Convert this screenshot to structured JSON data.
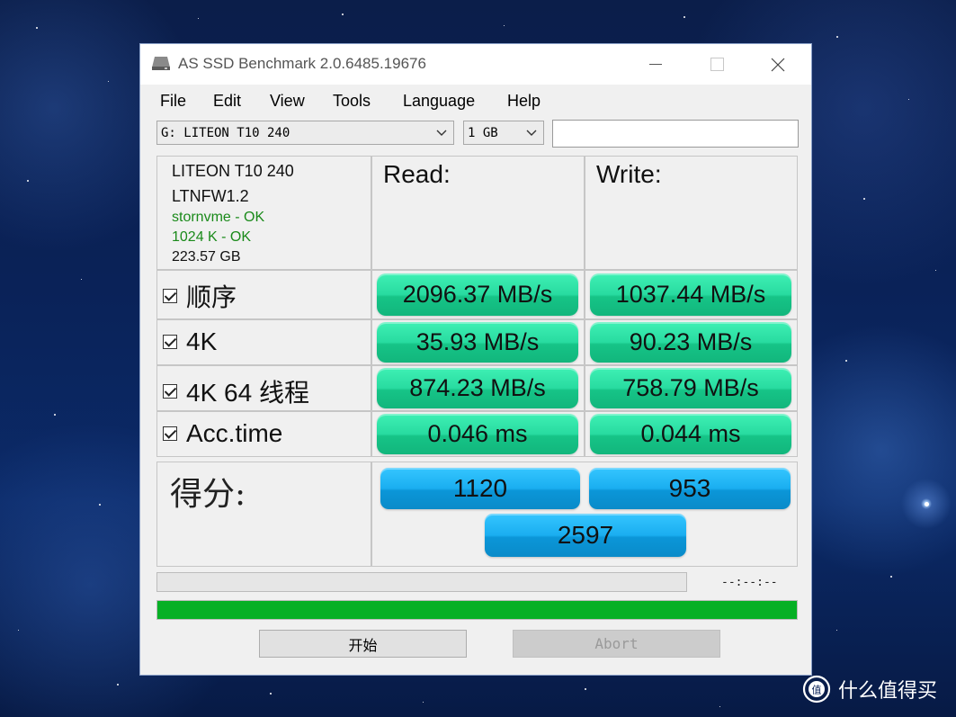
{
  "window": {
    "title": "AS SSD Benchmark 2.0.6485.19676"
  },
  "menu": {
    "items": [
      "File",
      "Edit",
      "View",
      "Tools",
      "Language",
      "Help"
    ]
  },
  "toolbar": {
    "drive_select": "G: LITEON T10 240",
    "size_select": "1 GB",
    "status_field": ""
  },
  "drive_info": {
    "model": "LITEON T10 240",
    "firmware": "LTNFW1.2",
    "driver_status": "stornvme - OK",
    "alignment_status": "1024 K - OK",
    "capacity": "223.57 GB"
  },
  "columns": {
    "read": "Read:",
    "write": "Write:"
  },
  "rows": [
    {
      "label": "顺序",
      "checked": true,
      "read": "2096.37 MB/s",
      "write": "1037.44 MB/s"
    },
    {
      "label": "4K",
      "checked": true,
      "read": "35.93 MB/s",
      "write": "90.23 MB/s"
    },
    {
      "label": "4K 64 线程",
      "checked": true,
      "read": "874.23 MB/s",
      "write": "758.79 MB/s"
    },
    {
      "label": "Acc.time",
      "checked": true,
      "read": "0.046 ms",
      "write": "0.044 ms"
    }
  ],
  "score": {
    "label": "得分:",
    "read": "1120",
    "write": "953",
    "total": "2597"
  },
  "progress": {
    "time_text": "--:--:--",
    "sub_progress_fraction": 0,
    "main_progress_fraction": 1.0
  },
  "buttons": {
    "start": "开始",
    "abort": "Abort"
  },
  "watermark": {
    "text": "什么值得买",
    "logo_glyph": "值"
  },
  "colors": {
    "result_green": "#28dba0",
    "score_blue": "#1aaef0",
    "progress_green": "#06b025",
    "ok_green": "#1a8a1a"
  }
}
